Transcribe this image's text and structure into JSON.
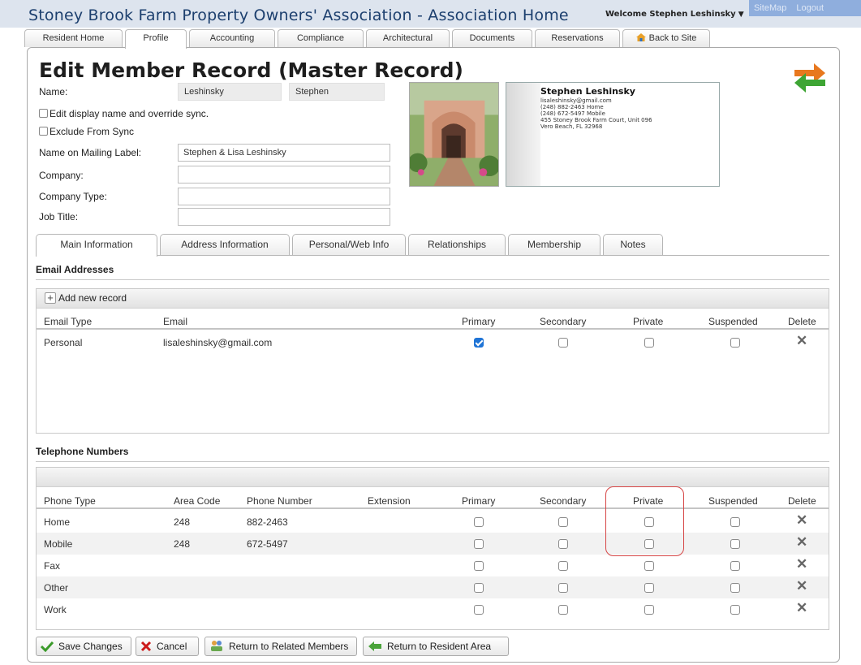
{
  "site": {
    "title": "Stoney Brook Farm Property Owners' Association - Association Home",
    "welcome": "Welcome Stephen Leshinsky",
    "links": [
      "SiteMap",
      "Logout"
    ]
  },
  "nav_tabs": [
    "Resident Home",
    "Profile",
    "Accounting",
    "Compliance",
    "Architectural",
    "Documents",
    "Reservations",
    "Back to Site"
  ],
  "active_nav_tab": "Profile",
  "page_title": "Edit Member Record (Master Record)",
  "form": {
    "name_label": "Name:",
    "last_name": "Leshinsky",
    "first_name": "Stephen",
    "edit_display_label": "Edit display name and override sync.",
    "exclude_sync_label": "Exclude From Sync",
    "mailing_label": "Name on Mailing Label:",
    "mailing_value": "Stephen & Lisa Leshinsky",
    "company_label": "Company:",
    "company_type_label": "Company Type:",
    "job_title_label": "Job Title:"
  },
  "card": {
    "name": "Stephen Leshinsky",
    "lines": [
      "lisaleshinsky@gmail.com",
      "(248) 882-2463 Home",
      "(248) 672-5497 Mobile",
      "455 Stoney Brook Farm Court, Unit 096",
      "Vero Beach, FL 32968"
    ]
  },
  "sub_tabs": [
    "Main Information",
    "Address Information",
    "Personal/Web Info",
    "Relationships",
    "Membership",
    "Notes"
  ],
  "active_sub_tab": "Main Information",
  "email": {
    "section_title": "Email Addresses",
    "add_label": "Add new record",
    "columns": [
      "Email Type",
      "Email",
      "Primary",
      "Secondary",
      "Private",
      "Suspended",
      "Delete"
    ],
    "rows": [
      {
        "type": "Personal",
        "email": "lisaleshinsky@gmail.com",
        "primary": true,
        "secondary": false,
        "private": false,
        "suspended": false
      }
    ]
  },
  "phone": {
    "section_title": "Telephone Numbers",
    "columns": [
      "Phone Type",
      "Area Code",
      "Phone Number",
      "Extension",
      "Primary",
      "Secondary",
      "Private",
      "Suspended",
      "Delete"
    ],
    "rows": [
      {
        "type": "Home",
        "area": "248",
        "number": "882-2463",
        "ext": ""
      },
      {
        "type": "Mobile",
        "area": "248",
        "number": "672-5497",
        "ext": ""
      },
      {
        "type": "Fax",
        "area": "",
        "number": "",
        "ext": ""
      },
      {
        "type": "Other",
        "area": "",
        "number": "",
        "ext": ""
      },
      {
        "type": "Work",
        "area": "",
        "number": "",
        "ext": ""
      }
    ]
  },
  "buttons": {
    "save": "Save Changes",
    "cancel": "Cancel",
    "related": "Return to Related Members",
    "resident": "Return to Resident Area"
  },
  "colors": {
    "accent": "#1f74d6",
    "highlight": "#d64545",
    "save_icon": "#3a9a2a",
    "cancel_icon": "#cc1a1a"
  }
}
